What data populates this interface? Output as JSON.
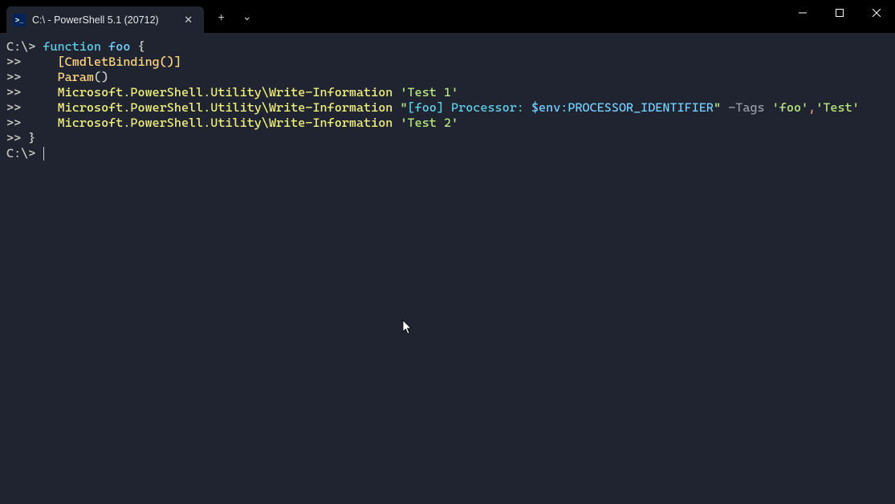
{
  "window": {
    "tab_title": "C:\\ - PowerShell 5.1 (20712)"
  },
  "icons": {
    "ps": ">_",
    "close_tab": "✕",
    "new_tab": "+",
    "dropdown": "⌄"
  },
  "terminal": {
    "lines": [
      {
        "segments": [
          {
            "cls": "fg",
            "text": "C:\\> "
          },
          {
            "cls": "kw",
            "text": "function"
          },
          {
            "cls": "fg",
            "text": " "
          },
          {
            "cls": "name",
            "text": "foo"
          },
          {
            "cls": "fg",
            "text": " {"
          }
        ]
      },
      {
        "segments": [
          {
            "cls": "fg",
            "text": ">>     "
          },
          {
            "cls": "attr",
            "text": "[CmdletBinding()]"
          }
        ]
      },
      {
        "segments": [
          {
            "cls": "fg",
            "text": ">>     "
          },
          {
            "cls": "attr",
            "text": "Param"
          },
          {
            "cls": "fg",
            "text": "()"
          }
        ]
      },
      {
        "segments": [
          {
            "cls": "fg",
            "text": ">>     "
          },
          {
            "cls": "cmd",
            "text": "Microsoft.PowerShell.Utility\\Write-Information"
          },
          {
            "cls": "fg",
            "text": " "
          },
          {
            "cls": "str",
            "text": "'Test 1'"
          }
        ]
      },
      {
        "segments": [
          {
            "cls": "fg",
            "text": ">>     "
          },
          {
            "cls": "cmd",
            "text": "Microsoft.PowerShell.Utility\\Write-Information"
          },
          {
            "cls": "fg",
            "text": " "
          },
          {
            "cls": "dstr",
            "text": "\""
          },
          {
            "cls": "interp",
            "text": "[foo] Processor: "
          },
          {
            "cls": "var",
            "text": "$env:PROCESSOR_IDENTIFIER"
          },
          {
            "cls": "dstr",
            "text": "\""
          },
          {
            "cls": "fg",
            "text": " "
          },
          {
            "cls": "param",
            "text": "-Tags"
          },
          {
            "cls": "fg",
            "text": " "
          },
          {
            "cls": "str",
            "text": "'foo'"
          },
          {
            "cls": "comma",
            "text": ","
          },
          {
            "cls": "str",
            "text": "'Test'"
          }
        ]
      },
      {
        "segments": [
          {
            "cls": "fg",
            "text": ">>     "
          },
          {
            "cls": "cmd",
            "text": "Microsoft.PowerShell.Utility\\Write-Information"
          },
          {
            "cls": "fg",
            "text": " "
          },
          {
            "cls": "str",
            "text": "'Test 2'"
          }
        ]
      },
      {
        "segments": [
          {
            "cls": "fg",
            "text": ">> }"
          }
        ]
      },
      {
        "segments": [
          {
            "cls": "fg",
            "text": "C:\\> "
          }
        ],
        "cursor": true
      }
    ]
  }
}
